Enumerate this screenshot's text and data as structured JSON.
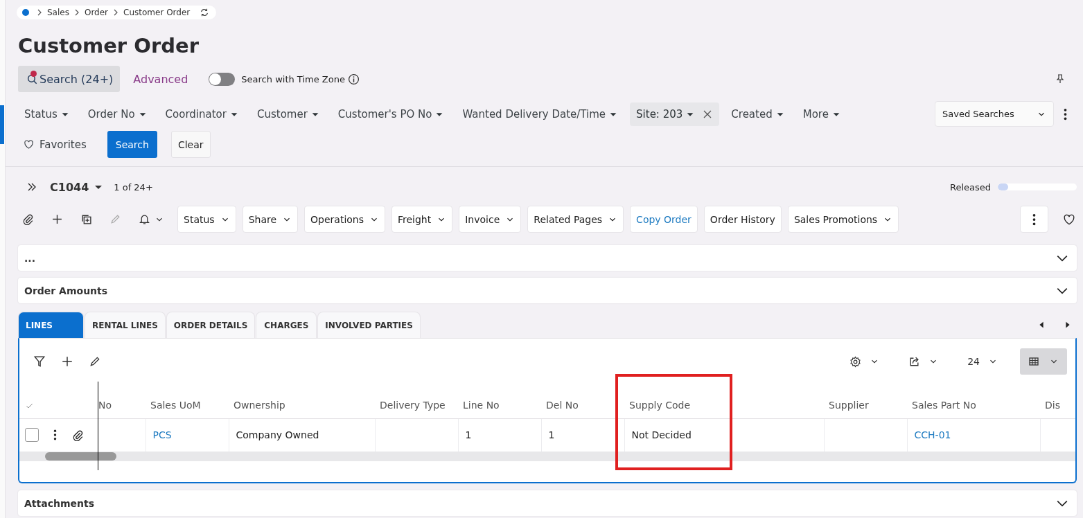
{
  "breadcrumb": [
    "Sales",
    "Order",
    "Customer Order"
  ],
  "title": "Customer Order",
  "search": {
    "button": "Search (24+)",
    "advanced": "Advanced",
    "time_zone_toggle": {
      "label": "Search with Time Zone",
      "on": false
    }
  },
  "filters": [
    {
      "label": "Status",
      "active": false
    },
    {
      "label": "Order No",
      "active": false
    },
    {
      "label": "Coordinator",
      "active": false
    },
    {
      "label": "Customer",
      "active": false
    },
    {
      "label": "Customer's PO No",
      "active": false
    },
    {
      "label": "Wanted Delivery Date/Time",
      "active": false
    },
    {
      "label": "Site: 203",
      "active": true
    },
    {
      "label": "Created",
      "active": false
    },
    {
      "label": "More",
      "active": false
    }
  ],
  "saved_searches": "Saved Searches",
  "favorites": "Favorites",
  "search_button": "Search",
  "clear_button": "Clear",
  "record": {
    "id": "C1044",
    "position": "1 of 24+",
    "status": "Released",
    "level": 0.13
  },
  "toolbar_icons": [
    {
      "kind": "attach",
      "disabled": false
    },
    {
      "kind": "add",
      "disabled": false
    },
    {
      "kind": "duplicate",
      "disabled": false
    },
    {
      "kind": "edit",
      "disabled": true
    },
    {
      "kind": "bell",
      "disabled": false
    }
  ],
  "actions": [
    {
      "label": "Status",
      "kind": "menu"
    },
    {
      "label": "Share",
      "kind": "menu"
    },
    {
      "label": "Operations",
      "kind": "menu"
    },
    {
      "label": "Freight",
      "kind": "menu"
    },
    {
      "label": "Invoice",
      "kind": "menu"
    },
    {
      "label": "Related Pages",
      "kind": "menu"
    },
    {
      "label": "Copy Order",
      "kind": "link"
    },
    {
      "label": "Order History",
      "kind": "plain"
    },
    {
      "label": "Sales Promotions",
      "kind": "menu"
    }
  ],
  "sections": [
    {
      "label": "...",
      "expanded": false
    },
    {
      "label": "Order Amounts",
      "expanded": false
    }
  ],
  "tabs": [
    {
      "label": "LINES",
      "selected": true
    },
    {
      "label": "RENTAL LINES",
      "selected": false
    },
    {
      "label": "ORDER DETAILS",
      "selected": false
    },
    {
      "label": "CHARGES",
      "selected": false
    },
    {
      "label": "INVOLVED PARTIES",
      "selected": false
    }
  ],
  "table": {
    "page_size": "24",
    "columns": [
      {
        "label": "No"
      },
      {
        "label": "Sales UoM"
      },
      {
        "label": "Ownership"
      },
      {
        "label": "Delivery Type"
      },
      {
        "label": "Line No"
      },
      {
        "label": "Del No"
      },
      {
        "label": "Supply Code",
        "annotation": {
          "kind": "rectangle"
        }
      },
      {
        "label": "Supplier"
      },
      {
        "label": "Sales Part No"
      },
      {
        "label": "Dis"
      }
    ],
    "rows": [
      {
        "selected": false,
        "cells": [
          {},
          {
            "text": "PCS",
            "link": true
          },
          {
            "text": "Company Owned"
          },
          {},
          {
            "text": "1"
          },
          {
            "text": "1"
          },
          {
            "text": "Not Decided"
          },
          {},
          {
            "text": "CCH-01",
            "link": true
          },
          {}
        ]
      }
    ]
  },
  "bottom_sections": [
    {
      "label": "Attachments",
      "expanded": false
    }
  ]
}
